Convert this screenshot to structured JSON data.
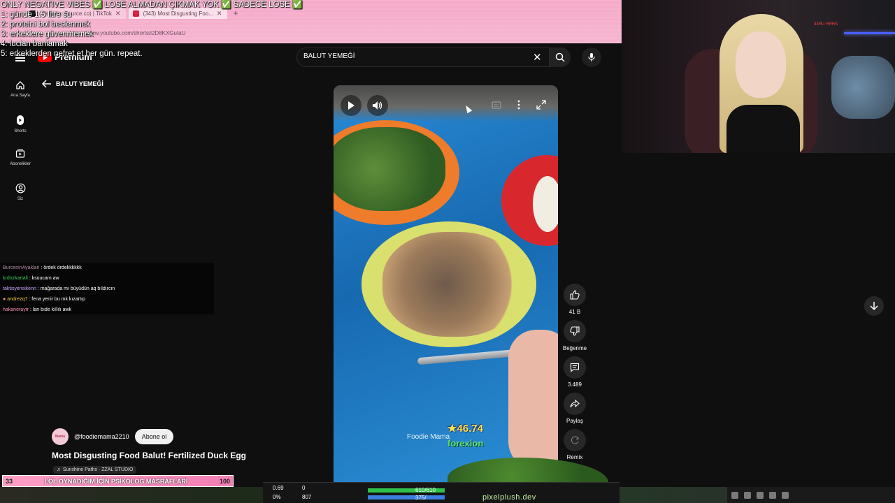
{
  "overlay": {
    "lines": [
      "ONLY NEGATIVE VIBES ✅ LOSE ALMADAN ÇIKMAK YOK ✅ SADECE LOSE ✅",
      "1: günde 1.5 litre su",
      "2: proteini bol beslenmek",
      "3: erkeklere güvenmemek",
      "4: lucian banlamak",
      "5: erkeklerden nefret et her gün. repeat."
    ]
  },
  "browser": {
    "tabs": [
      {
        "label": "(Favorite: Source.co) | TikTok"
      },
      {
        "label": "(343) Most Disgusting Foo..."
      }
    ],
    "url": "https://www.youtube.com/shorts/i2D8KXGuIaU"
  },
  "youtube": {
    "logo_text": "Premium",
    "search_query": "BALUT YEMEĞİ",
    "back_label": "BALUT YEMEĞİ",
    "nav": [
      {
        "label": "Ana Sayfa",
        "icon": "home-icon"
      },
      {
        "label": "Shorts",
        "icon": "shorts-icon"
      },
      {
        "label": "Abonelikler",
        "icon": "subscriptions-icon"
      },
      {
        "label": "Siz",
        "icon": "you-icon"
      }
    ]
  },
  "chat": [
    {
      "user": "BurceninAyaklari",
      "msg": "ördek ördekkkkkk"
    },
    {
      "user": "krdnzkartali",
      "msg": "ksuucam aw"
    },
    {
      "user": "taktisyensikenn",
      "msg": "mağarada mı büyüdün aq bıldırcın"
    },
    {
      "user": "andrezq7",
      "msg": "fena yenir bu mk kızartıp"
    },
    {
      "user": "hakaneraytr",
      "msg": "lan bıde kıllılı awk"
    }
  ],
  "video": {
    "watermark": "Foodie Mama",
    "score": "★46.74",
    "score_user": "forexion"
  },
  "actions": {
    "like_count": "41 B",
    "dislike_label": "Beğenme",
    "comment_count": "3.489",
    "share_label": "Paylaş",
    "remix_label": "Remix"
  },
  "channel": {
    "avatar_text": "Mama",
    "handle": "@foodiemama2210",
    "subscribe_label": "Abone ol",
    "title": "Most Disgusting Food Balut! Fertilized Duck Egg",
    "sound": "♬ Sunshine Paths · ZZAL STUDIO"
  },
  "stream_bar": {
    "left": "33",
    "text": "LOL OYNADIĞIM İÇİN PSİKOLOG MASRAFLARI",
    "right": "100"
  },
  "hud": {
    "kda": "0.69",
    "cs": "0",
    "pct": "0%",
    "gold": "807",
    "hp": "610/610",
    "mana": "375/"
  },
  "branding": {
    "pixelplush": "pixelplush.dev"
  },
  "webcam": {
    "label": "33ЯU ЯЯHS"
  },
  "colors": {
    "accent": "#ff0000",
    "chrome_pink": "#f4a9c8",
    "bg": "#0f0f0f"
  }
}
